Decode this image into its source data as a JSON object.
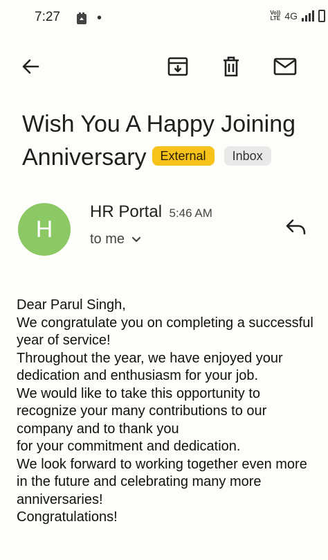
{
  "status_bar": {
    "time": "7:27",
    "notification_dot": "•",
    "volte_top": "Vo))",
    "volte_bottom": "LTE",
    "network": "4G"
  },
  "toolbar": {
    "back_icon": "arrow-back-icon",
    "archive_icon": "archive-icon",
    "delete_icon": "delete-icon",
    "mail_icon": "mark-unread-icon"
  },
  "email": {
    "subject": "Wish You A Happy Joining Anniversary",
    "labels": [
      "External",
      "Inbox"
    ],
    "label_colors": {
      "external": "#f7c21a",
      "inbox": "#e9e9e9"
    },
    "sender": {
      "initial": "H",
      "name": "HR Portal",
      "time": "5:46 AM",
      "avatar_color": "#8cc864"
    },
    "recipient": "to me",
    "body_lines": [
      "Dear Parul Singh,",
      "We congratulate you on completing a successful",
      "year of service!",
      "Throughout the year, we have enjoyed your",
      "dedication and enthusiasm for your job.",
      "We would like to take this opportunity to",
      "recognize your many contributions to our",
      "company and to thank you",
      "for your commitment and dedication.",
      "We look forward to working together even more",
      "in the future and celebrating many more",
      "anniversaries!",
      "Congratulations!"
    ]
  }
}
